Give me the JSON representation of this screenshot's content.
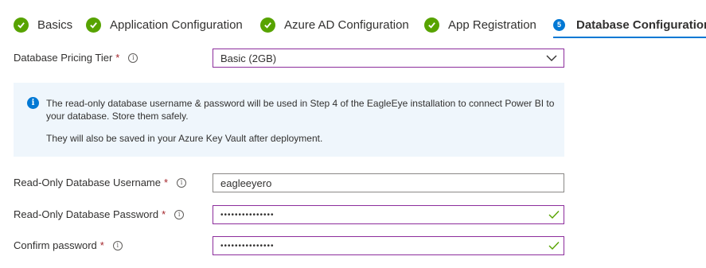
{
  "tabs": [
    {
      "label": "Basics",
      "state": "complete"
    },
    {
      "label": "Application Configuration",
      "state": "complete"
    },
    {
      "label": "Azure AD Configuration",
      "state": "complete"
    },
    {
      "label": "App Registration",
      "state": "complete"
    },
    {
      "label": "Database Configuration",
      "state": "active",
      "step": "5"
    }
  ],
  "pricing_tier": {
    "label": "Database Pricing Tier",
    "required": "*",
    "value": "Basic (2GB)"
  },
  "info": {
    "line1": "The read-only database username & password will be used in Step 4 of the EagleEye installation to connect Power BI to your database. Store them safely.",
    "line2": "They will also be saved in your Azure Key Vault after deployment."
  },
  "username": {
    "label": "Read-Only Database Username",
    "required": "*",
    "value": "eagleeyero"
  },
  "password": {
    "label": "Read-Only Database Password",
    "required": "*",
    "value": "•••••••••••••••"
  },
  "confirm": {
    "label": "Confirm password",
    "required": "*",
    "value": "•••••••••••••••"
  },
  "colors": {
    "accent": "#0078d4",
    "success": "#57a300",
    "focus_border": "#8c2d9c",
    "required": "#a4262c",
    "info_bg": "#eff6fc"
  }
}
